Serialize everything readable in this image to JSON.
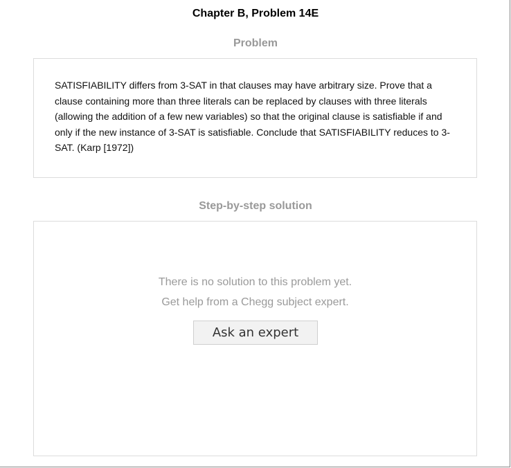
{
  "page": {
    "title": "Chapter B, Problem 14E"
  },
  "problem": {
    "heading": "Problem",
    "text": "SATISFIABILITY differs from 3-SAT in that clauses may have arbitrary size. Prove that a clause containing more than three literals can be replaced by clauses with three literals (allowing the addition of a few new variables) so that the original clause is satisfiable if and only if the new instance of 3-SAT is satisfiable. Conclude that SATISFIABILITY reduces to 3-SAT. (Karp [1972])"
  },
  "solution": {
    "heading": "Step-by-step solution",
    "empty_message_line1": "There is no solution to this problem yet.",
    "empty_message_line2": "Get help from a Chegg subject expert.",
    "ask_button_label": "Ask an expert"
  },
  "colors": {
    "heading_gray": "#999999",
    "border": "#dcdcdc",
    "button_bg": "#f2f2f2"
  }
}
